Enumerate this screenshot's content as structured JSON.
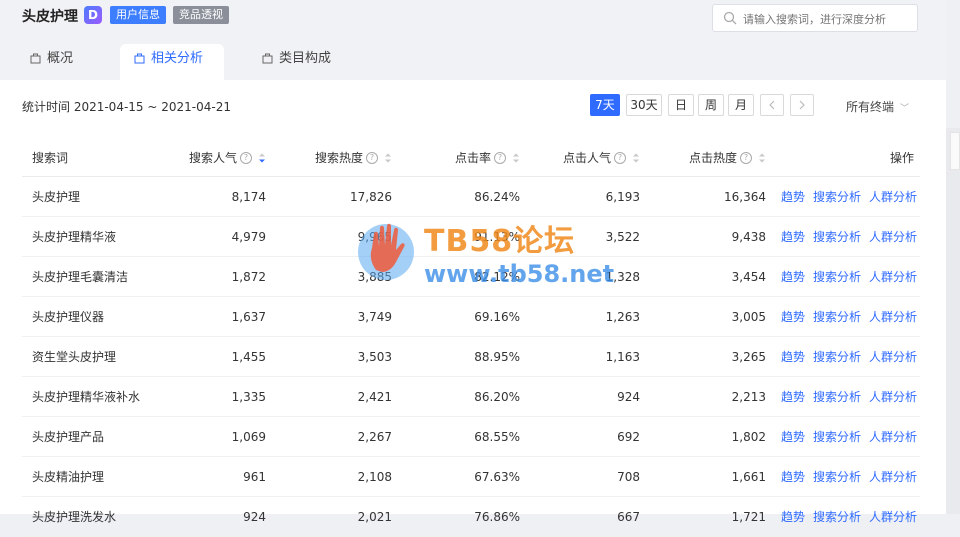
{
  "header": {
    "title": "头皮护理",
    "app_icon_letter": "D",
    "badge_user": "用户信息",
    "badge_product": "竞品透视",
    "search_placeholder": "请输入搜索词，进行深度分析"
  },
  "tabs": [
    {
      "label": "概况"
    },
    {
      "label": "相关分析"
    },
    {
      "label": "类目构成"
    }
  ],
  "active_tab": "相关分析",
  "toolbar": {
    "date_range": "统计时间 2021-04-15 ~ 2021-04-21",
    "periods": [
      "7天",
      "30天",
      "日",
      "周",
      "月"
    ],
    "active_period": "7天",
    "terminal": "所有终端"
  },
  "table": {
    "columns": [
      "搜索词",
      "搜索人气",
      "搜索热度",
      "点击率",
      "点击人气",
      "点击热度",
      "操作"
    ],
    "rows": [
      {
        "term": "头皮护理",
        "search_pop": "8,174",
        "search_heat": "17,826",
        "ctr": "86.24%",
        "click_pop": "6,193",
        "click_heat": "16,364"
      },
      {
        "term": "头皮护理精华液",
        "search_pop": "4,979",
        "search_heat": "9,965",
        "ctr": "91.13%",
        "click_pop": "3,522",
        "click_heat": "9,438"
      },
      {
        "term": "头皮护理毛囊清洁",
        "search_pop": "1,872",
        "search_heat": "3,885",
        "ctr": "82.12%",
        "click_pop": "1,328",
        "click_heat": "3,454"
      },
      {
        "term": "头皮护理仪器",
        "search_pop": "1,637",
        "search_heat": "3,749",
        "ctr": "69.16%",
        "click_pop": "1,263",
        "click_heat": "3,005"
      },
      {
        "term": "资生堂头皮护理",
        "search_pop": "1,455",
        "search_heat": "3,503",
        "ctr": "88.95%",
        "click_pop": "1,163",
        "click_heat": "3,265"
      },
      {
        "term": "头皮护理精华液补水",
        "search_pop": "1,335",
        "search_heat": "2,421",
        "ctr": "86.20%",
        "click_pop": "924",
        "click_heat": "2,213"
      },
      {
        "term": "头皮护理产品",
        "search_pop": "1,069",
        "search_heat": "2,267",
        "ctr": "68.55%",
        "click_pop": "692",
        "click_heat": "1,802"
      },
      {
        "term": "头皮精油护理",
        "search_pop": "961",
        "search_heat": "2,108",
        "ctr": "67.63%",
        "click_pop": "708",
        "click_heat": "1,661"
      },
      {
        "term": "头皮护理洗发水",
        "search_pop": "924",
        "search_heat": "2,021",
        "ctr": "76.86%",
        "click_pop": "667",
        "click_heat": "1,721"
      }
    ],
    "actions": [
      "趋势",
      "搜索分析",
      "人群分析"
    ]
  },
  "watermark": {
    "title": "TB58论坛",
    "url": "www.tb58.net"
  },
  "colors": {
    "accent": "#2f6bff",
    "badge_blue": "#3d7dff",
    "badge_gray": "#8a8f99",
    "watermark_orange": "#f08a1e",
    "watermark_blue": "#3b8fe8"
  }
}
